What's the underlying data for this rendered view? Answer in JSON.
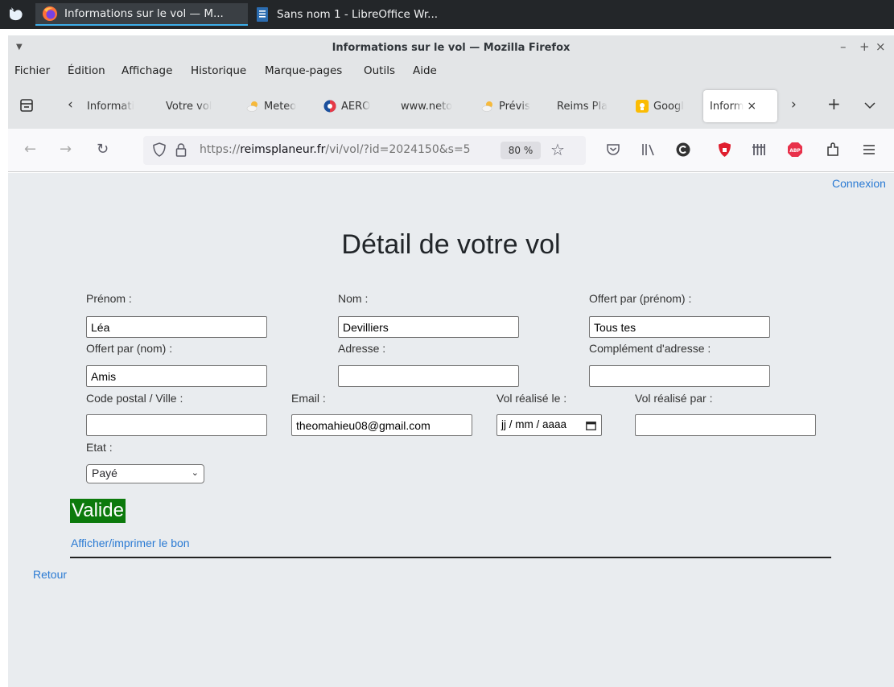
{
  "taskbar": {
    "tasks": [
      {
        "title": "Informations sur le vol — M...",
        "icon": "firefox-icon"
      },
      {
        "title": "Sans nom 1 - LibreOffice Wr...",
        "icon": "libreoffice-writer-icon"
      }
    ]
  },
  "window": {
    "title": "Informations sur le vol — Mozilla Firefox",
    "controls": {
      "minimize": "–",
      "maximize": "+",
      "close": "×"
    }
  },
  "menubar": {
    "items": [
      "Fichier",
      "Édition",
      "Affichage",
      "Historique",
      "Marque-pages",
      "Outils",
      "Aide"
    ]
  },
  "tabs": {
    "items": [
      {
        "label": "Informati",
        "icon": "none"
      },
      {
        "label": "Votre vol",
        "icon": "none"
      },
      {
        "label": "Meteo",
        "icon": "weather-icon"
      },
      {
        "label": "AERO",
        "icon": "aero-icon"
      },
      {
        "label": "www.neto",
        "icon": "none"
      },
      {
        "label": "Prévis",
        "icon": "weather-icon"
      },
      {
        "label": "Reims Pla",
        "icon": "none"
      },
      {
        "label": "Googl",
        "icon": "google-icon"
      }
    ],
    "selected": {
      "label": "Inform",
      "close": "×"
    }
  },
  "navbar": {
    "url_prefix": "https://",
    "url_host": "reimsplaneur.fr",
    "url_path": "/vi/vol/?id=2024150&s=5",
    "zoom": "80 %"
  },
  "page": {
    "login_link": "Connexion",
    "title": "Détail de votre vol",
    "fields": {
      "prenom": {
        "label": "Prénom :",
        "value": "Léa"
      },
      "nom": {
        "label": "Nom :",
        "value": "Devilliers"
      },
      "offert_prenom": {
        "label": "Offert par (prénom) :",
        "value": "Tous tes"
      },
      "offert_nom": {
        "label": "Offert par (nom) :",
        "value": "Amis"
      },
      "adresse": {
        "label": "Adresse :",
        "value": ""
      },
      "complement": {
        "label": "Complément d'adresse :",
        "value": ""
      },
      "cp_ville": {
        "label": "Code postal / Ville :",
        "value": ""
      },
      "email": {
        "label": "Email :",
        "value": "theomahieu08@gmail.com"
      },
      "date_vol": {
        "label": "Vol réalisé le :",
        "placeholder": "jj / mm / aaaa"
      },
      "pilote": {
        "label": "Vol réalisé par :",
        "value": ""
      },
      "etat": {
        "label": "Etat :",
        "value": "Payé"
      }
    },
    "status": "Valide",
    "print_link": "Afficher/imprimer le bon",
    "back_link": "Retour"
  },
  "colors": {
    "status_bg": "#0c7a0c",
    "link": "#2a7ad3",
    "content_bg": "#e9ecef"
  }
}
